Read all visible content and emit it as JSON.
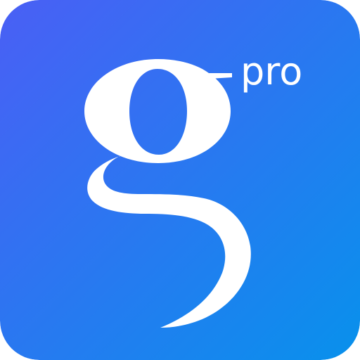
{
  "icon": {
    "glyph_name": "letter-g-icon",
    "badge_text": "pro",
    "colors": {
      "gradient_start": "#4a5ff5",
      "gradient_end": "#0891ec",
      "foreground": "#ffffff"
    }
  }
}
